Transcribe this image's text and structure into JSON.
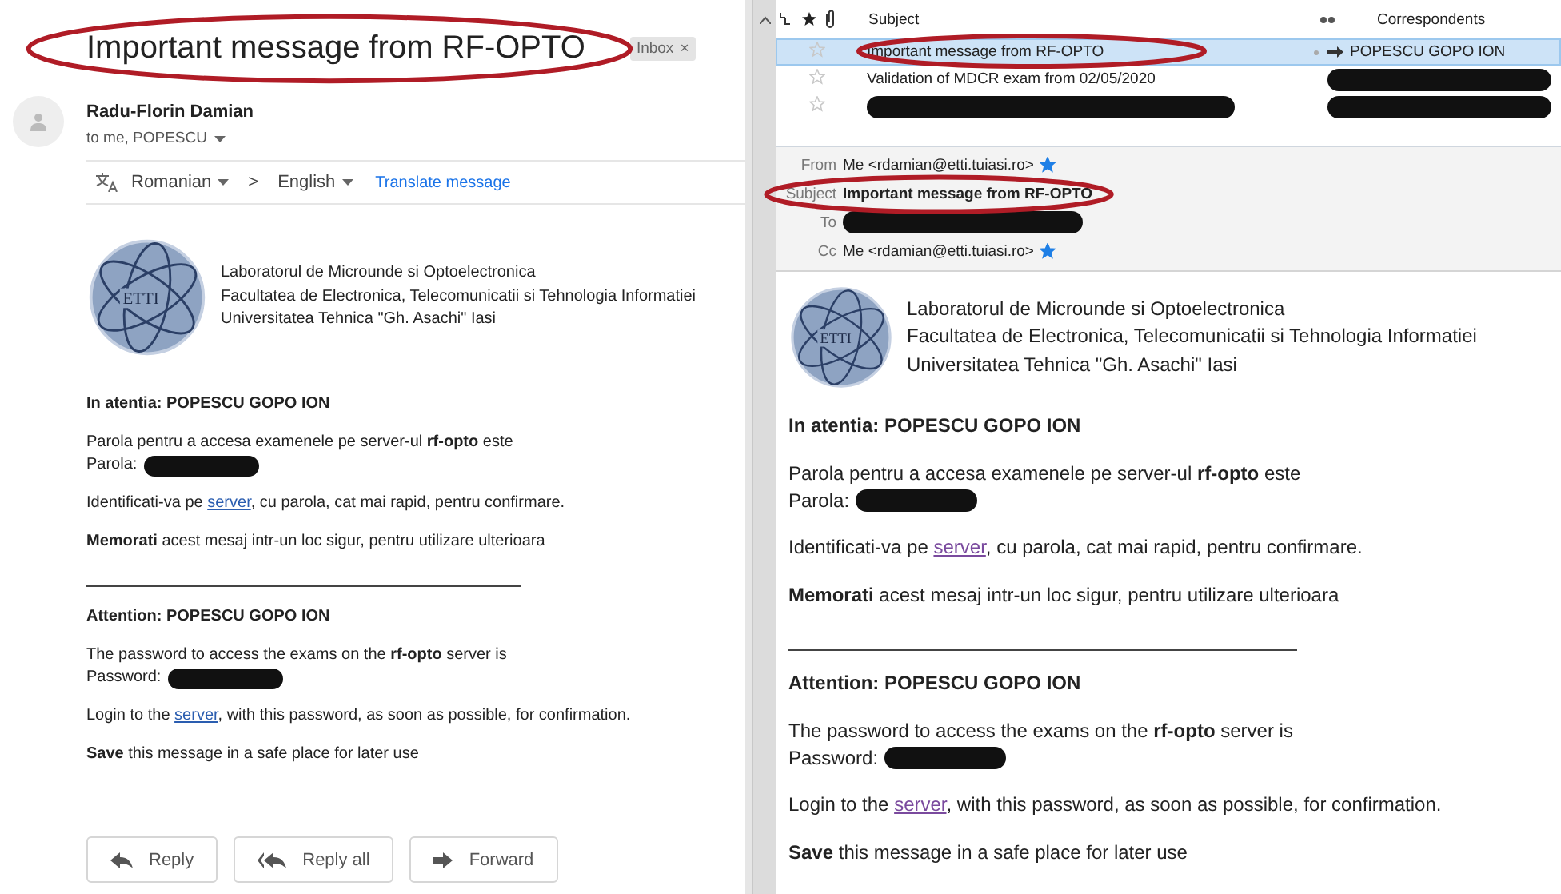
{
  "gmail": {
    "subject": "Important message from RF-OPTO",
    "label": "Inbox",
    "label_close": "×",
    "sender": "Radu-Florin Damian",
    "recipients": "to me, POPESCU",
    "translate": {
      "from": "Romanian",
      "separator": ">",
      "to": "English",
      "action": "Translate message"
    },
    "logo_text": "ETTI",
    "letterhead": [
      "Laboratorul de Microunde si Optoelectronica",
      "Facultatea de Electronica, Telecomunicatii si Tehnologia Informatiei",
      "Universitatea Tehnica \"Gh. Asachi\" Iasi"
    ],
    "body": [
      {
        "kind": "heading",
        "text": "In atentia: POPESCU GOPO ION"
      },
      {
        "kind": "secret",
        "text": "Parola pentru a accesa examenele pe server-ul **rf-opto** este",
        "label": "Parola:"
      },
      {
        "kind": "link",
        "before": "Identificati-va pe ",
        "link": "server",
        "after": ", cu parola, cat mai rapid, pentru confirmare.",
        "visited": false
      },
      {
        "kind": "text",
        "text": "**Memorati** acest mesaj intr-un loc sigur, pentru utilizare ulterioara"
      },
      {
        "kind": "rule"
      },
      {
        "kind": "heading",
        "text": "Attention: POPESCU GOPO ION"
      },
      {
        "kind": "secret",
        "text": "The password to access the exams on the **rf-opto** server is",
        "label": "Password:"
      },
      {
        "kind": "link",
        "before": "Login to the ",
        "link": "server",
        "after": ", with this password, as soon as possible, for confirmation.",
        "visited": false
      },
      {
        "kind": "text",
        "text": "**Save** this message in a safe place for later use"
      }
    ],
    "buttons": [
      {
        "kind": "reply",
        "label": "Reply"
      },
      {
        "kind": "reply_all",
        "label": "Reply all"
      },
      {
        "kind": "forward",
        "label": "Forward"
      }
    ]
  },
  "thunderbird": {
    "columns": {
      "subject": "Subject",
      "correspondents": "Correspondents"
    },
    "messages": [
      {
        "subject": "Important message from RF-OPTO",
        "correspondent": "POPESCU GOPO ION",
        "subject_hidden": false,
        "correspondent_hidden": false,
        "selected": true
      },
      {
        "subject": "Validation of MDCR exam from 02/05/2020",
        "subject_hidden": false,
        "correspondent_hidden": true,
        "selected": false
      },
      {
        "subject_hidden": true,
        "correspondent_hidden": true,
        "selected": false
      }
    ],
    "headers": [
      {
        "label": "From",
        "value": "Me <rdamian@etti.tuiasi.ro>",
        "hidden": false,
        "starred": true,
        "bold": false
      },
      {
        "label": "Subject",
        "value": "Important message from RF-OPTO",
        "hidden": false,
        "starred": false,
        "bold": true
      },
      {
        "label": "To",
        "hidden": true,
        "starred": false
      },
      {
        "label": "Cc",
        "value": "Me <rdamian@etti.tuiasi.ro>",
        "hidden": false,
        "starred": true,
        "bold": false
      }
    ],
    "logo_text": "ETTI",
    "letterhead": [
      "Laboratorul de Microunde si Optoelectronica",
      "Facultatea de Electronica, Telecomunicatii si Tehnologia Informatiei",
      "Universitatea Tehnica \"Gh. Asachi\" Iasi"
    ],
    "body": [
      {
        "kind": "heading",
        "text": "In atentia: POPESCU GOPO ION"
      },
      {
        "kind": "secret",
        "text": "Parola pentru a accesa examenele pe server-ul **rf-opto** este",
        "label": "Parola:"
      },
      {
        "kind": "link",
        "before": "Identificati-va pe ",
        "link": "server",
        "after": ", cu parola, cat mai rapid, pentru confirmare.",
        "visited": true
      },
      {
        "kind": "text",
        "text": "**Memorati** acest mesaj intr-un loc sigur, pentru utilizare ulterioara"
      },
      {
        "kind": "rule"
      },
      {
        "kind": "heading",
        "text": "Attention: POPESCU GOPO ION"
      },
      {
        "kind": "secret",
        "text": "The password to access the exams on the **rf-opto** server is",
        "label": "Password:"
      },
      {
        "kind": "link",
        "before": "Login to the ",
        "link": "server",
        "after": ", with this password, as soon as possible, for confirmation.",
        "visited": true
      },
      {
        "kind": "text",
        "text": "**Save** this message in a safe place for later use"
      }
    ]
  }
}
